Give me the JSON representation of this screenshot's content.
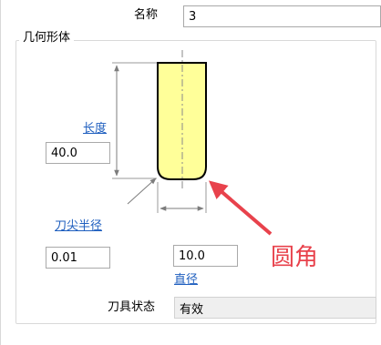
{
  "name_row": {
    "label": "名称",
    "value": "3"
  },
  "geometry_group": {
    "title": "几何形体",
    "length": {
      "link": "长度",
      "value": "40.0"
    },
    "corner_radius": {
      "link": "刀尖半径",
      "value": "0.01"
    },
    "diameter": {
      "link": "直径",
      "value": "10.0"
    },
    "status": {
      "label": "刀具状态",
      "value": "有效"
    }
  },
  "annotation": {
    "text": "圆角",
    "color": "#e8424c"
  },
  "colors": {
    "tool_fill": "#ffff99",
    "link": "#1f5fbf",
    "dimension_line": "#8a8a8a"
  }
}
